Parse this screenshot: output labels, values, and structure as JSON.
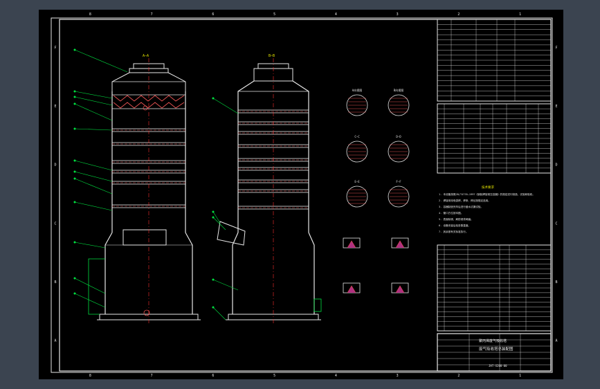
{
  "app": {
    "background_color": "#3b4450",
    "paper_color": "#000000",
    "colors": {
      "line": "#e8e8e8",
      "center_line": "#ff3030",
      "leader": "#00e040",
      "text": "#e6e600",
      "section": "#e05050"
    }
  },
  "border": {
    "column_labels": [
      "1",
      "2",
      "3",
      "4",
      "5",
      "6",
      "7",
      "8"
    ],
    "row_labels": [
      "F",
      "E",
      "D",
      "C",
      "B",
      "A"
    ]
  },
  "views": {
    "front_title": "A—A",
    "side_title": "B—B"
  },
  "details": {
    "rows": [
      [
        "A向视图",
        "B向视图"
      ],
      [
        "C—C",
        "D—D"
      ],
      [
        "E—E",
        "F—F"
      ]
    ]
  },
  "notes": {
    "heading": "技术要求",
    "items": [
      "1. 本设备按照JB/T4735—1997《钢制焊接常压容器》的规定进行制造、试验和验收。",
      "2. 焊接采用电弧焊，焊条、焊丝按规定选用。",
      "3. 容器制造完毕后进行盛水试漏试验。",
      "4. 管口方位按本图。",
      "5. 表面除锈，刷防锈漆两遍。",
      "6. 设备安装后检查垂直度。",
      "7. 其余按有关标准执行。"
    ]
  },
  "title_block": {
    "company": "聚丙烯废气吸收塔",
    "title": "废气吸收塔总装配图",
    "drawing_no": "JHT-X200-00"
  }
}
